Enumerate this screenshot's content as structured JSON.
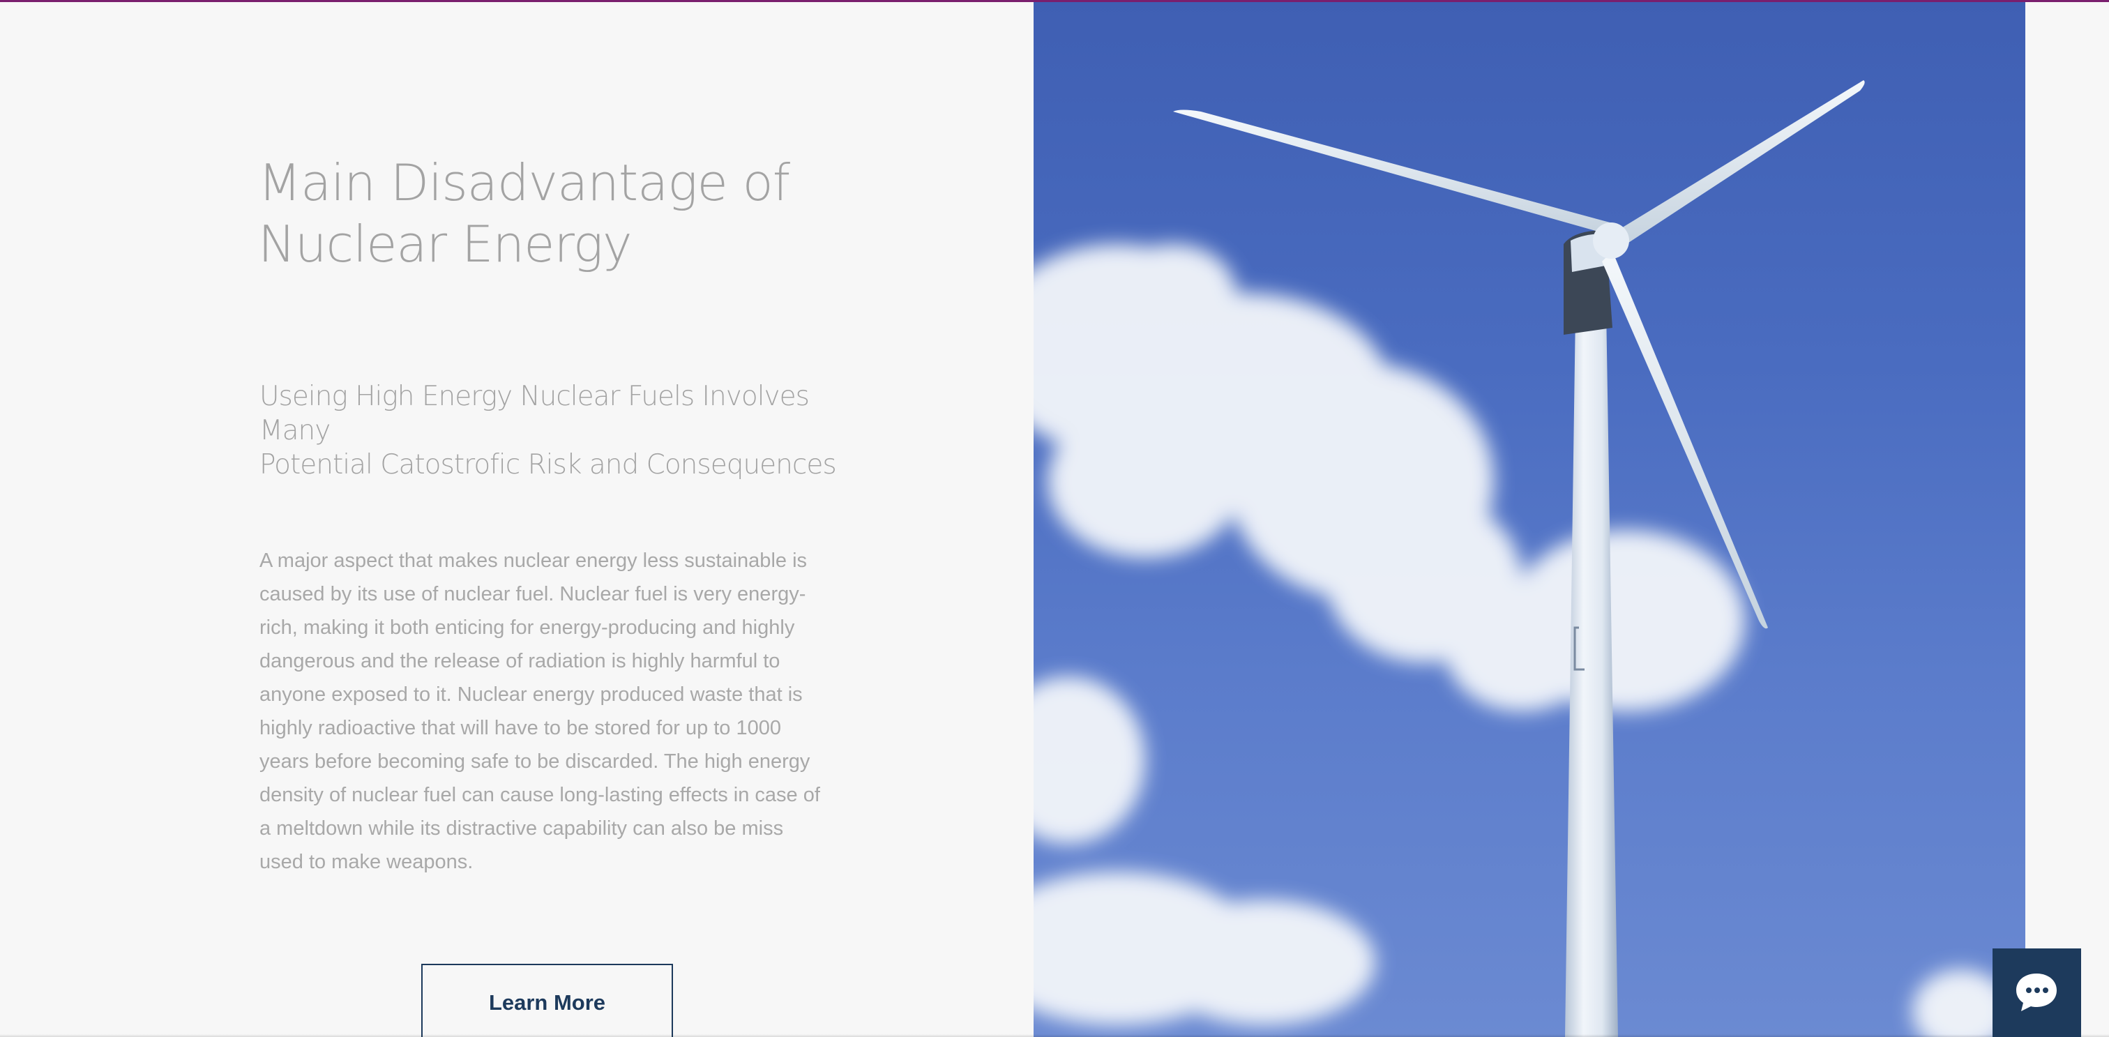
{
  "section": {
    "heading_line1": "Main Disadvantage of",
    "heading_line2": "Nuclear Energy",
    "subheading_line1": "Useing High Energy Nuclear Fuels Involves Many",
    "subheading_line2": "Potential Catostrofic Risk and Consequences",
    "body_lines": [
      "A major aspect that makes nuclear energy less sustainable is",
      "caused by its use of nuclear fuel. Nuclear fuel is very energy-",
      "rich, making it both enticing for energy-producing and highly",
      "dangerous and the release of radiation is highly harmful to",
      "anyone exposed to it. Nuclear energy produced waste that is",
      "highly radioactive that will have to be stored for up to 1000",
      "years before becoming safe to be discarded. The high energy",
      "density of nuclear fuel can cause long-lasting effects in case of",
      "a meltdown while its distractive capability can also be miss",
      "used to make weapons."
    ],
    "button_label": "Learn More"
  },
  "image": {
    "subject": "wind-turbine-photo"
  },
  "chat": {
    "icon": "chat-bubble-icon"
  },
  "colors": {
    "accent_bar": "#7a1f6e",
    "button_border": "#1d3a5c",
    "chat_bg": "#1d3a5c",
    "sky": "#4a6cc0",
    "text_gray": "#a3a3a3"
  }
}
